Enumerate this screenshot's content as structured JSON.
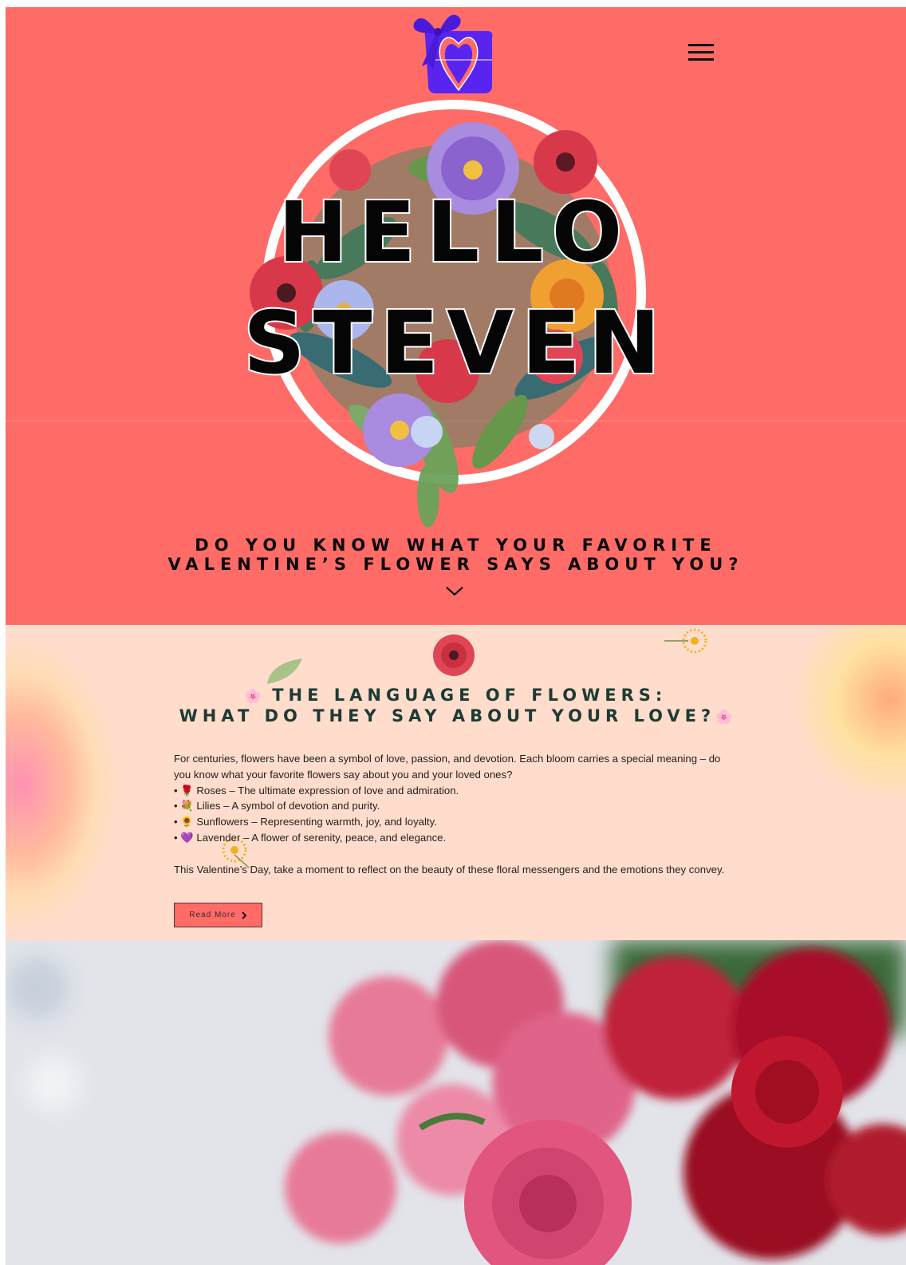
{
  "hero": {
    "greeting_line1": "HELLO",
    "greeting_line2": "STEVEN",
    "question_line1": "DO YOU KNOW WHAT YOUR FAVORITE",
    "question_line2": "VALENTINE’S FLOWER SAYS ABOUT YOU?",
    "background_color": "#ff6b66",
    "logo_color": "#5a24f0"
  },
  "icons": {
    "menu": "hamburger-menu-icon",
    "scroll": "chevron-down-icon",
    "read_more_arrow": "chevron-right-icon"
  },
  "language": {
    "title_line1": "THE LANGUAGE OF FLOWERS:",
    "title_line2": "WHAT DO THEY SAY ABOUT YOUR LOVE?",
    "title_emoji": "🌸",
    "intro": "For centuries, flowers have been a symbol of love, passion, and devotion. Each bloom carries a special meaning – do you know what your favorite flowers say about you and your loved ones?",
    "items": [
      "• 🌹 Roses – The ultimate expression of love and admiration.",
      "• 💐 Lilies – A symbol of devotion and purity.",
      "• 🌻 Sunflowers – Representing warmth, joy, and loyalty.",
      "• 💜 Lavender – A flower of serenity, peace, and elegance."
    ],
    "closing": "This Valentine’s Day, take a moment to reflect on the beauty of these floral messengers and the emotions they convey.",
    "read_more_label": "Read More",
    "background_color": "#ffdccb"
  }
}
